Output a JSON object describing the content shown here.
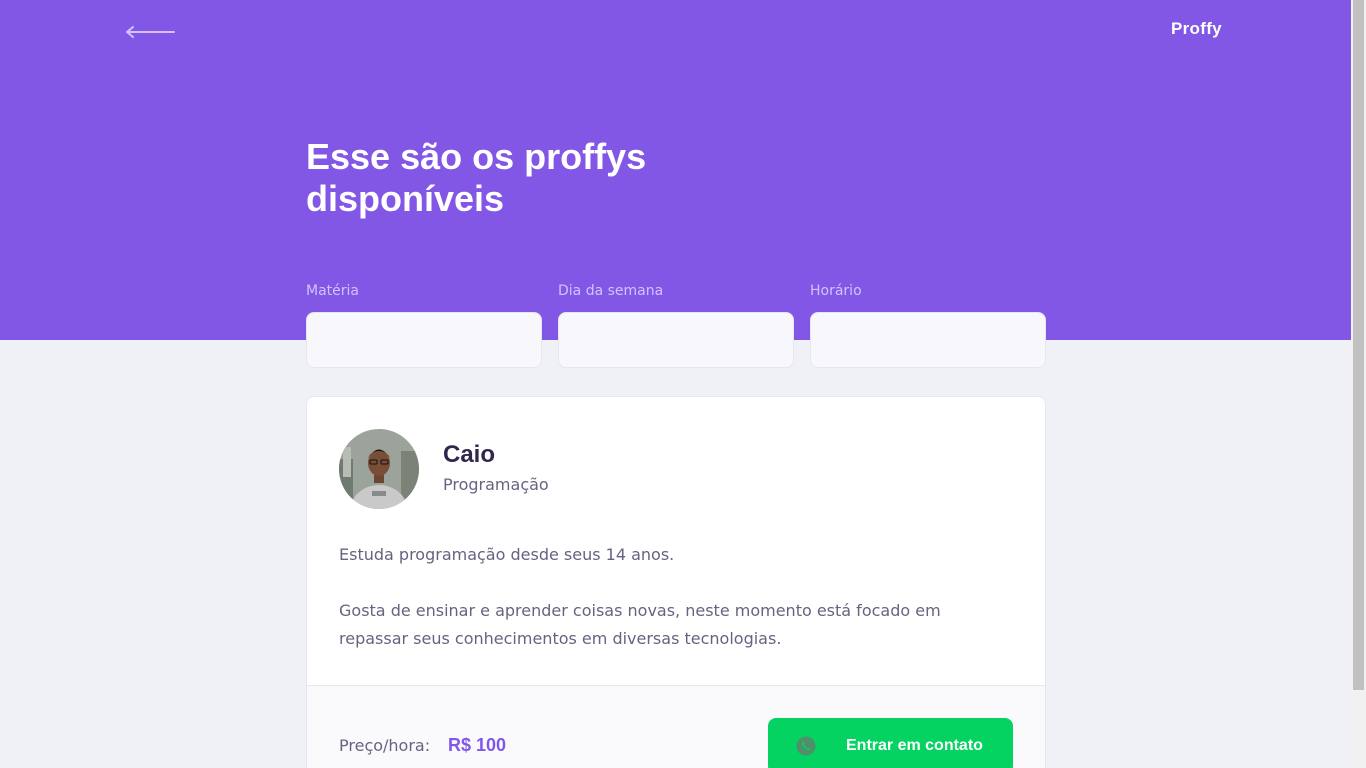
{
  "header": {
    "back_icon": "arrow-left-icon",
    "logo": "Proffy"
  },
  "page": {
    "title_line1": "Esse são os proffys",
    "title_line2": "disponíveis"
  },
  "filters": {
    "subject_label": "Matéria",
    "subject_value": "",
    "weekday_label": "Dia da semana",
    "weekday_value": "",
    "time_label": "Horário",
    "time_value": ""
  },
  "teacher": {
    "name": "Caio",
    "subject": "Programação",
    "bio_1": "Estuda programação desde seus 14 anos.",
    "bio_2": "Gosta de ensinar e aprender coisas novas, neste momento está focado em repassar seus conhecimentos em diversas tecnologias.",
    "price_label": "Preço/hora:",
    "price_value": "R$ 100",
    "contact_label": "Entrar em contato",
    "contact_icon": "whatsapp-icon"
  },
  "colors": {
    "primary": "#8257e5",
    "background": "#f0f0f7",
    "secondary": "#04d361",
    "title_text": "#32264d",
    "body_text": "#6a6180"
  }
}
